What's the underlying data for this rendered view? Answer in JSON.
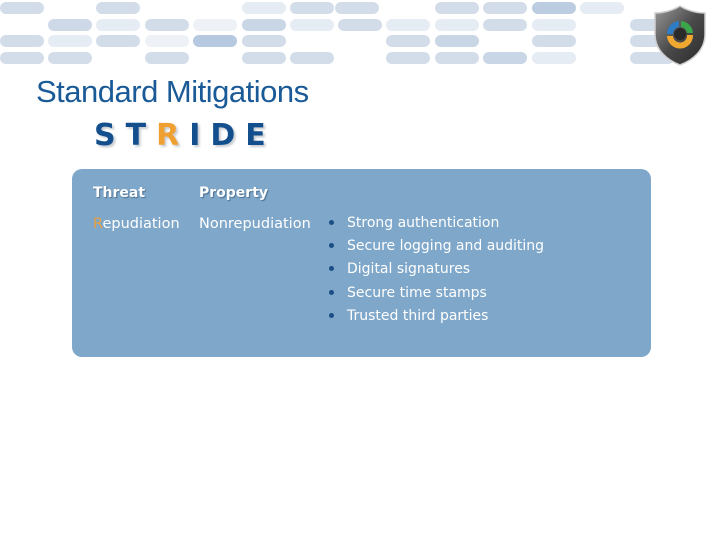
{
  "slide": {
    "title": "Standard Mitigations",
    "acronym": {
      "letters": [
        "S",
        "T",
        "R",
        "I",
        "D",
        "E"
      ],
      "highlighted_index": 2,
      "highlight_color": "#f0a030",
      "base_color": "#134f8d"
    },
    "logo_icon": "shield-cycle-icon"
  },
  "table": {
    "headers": {
      "threat": "Threat",
      "property": "Property"
    },
    "row": {
      "threat_first_letter": "R",
      "threat_rest": "epudiation",
      "property": "Nonrepudiation",
      "mitigations": [
        "Strong authentication",
        "Secure logging and auditing",
        "Digital signatures",
        "Secure time stamps",
        "Trusted third parties"
      ]
    }
  },
  "colors": {
    "panel": "#7fa7c9",
    "title": "#1a5a96",
    "bullet": "#1a4f86"
  }
}
